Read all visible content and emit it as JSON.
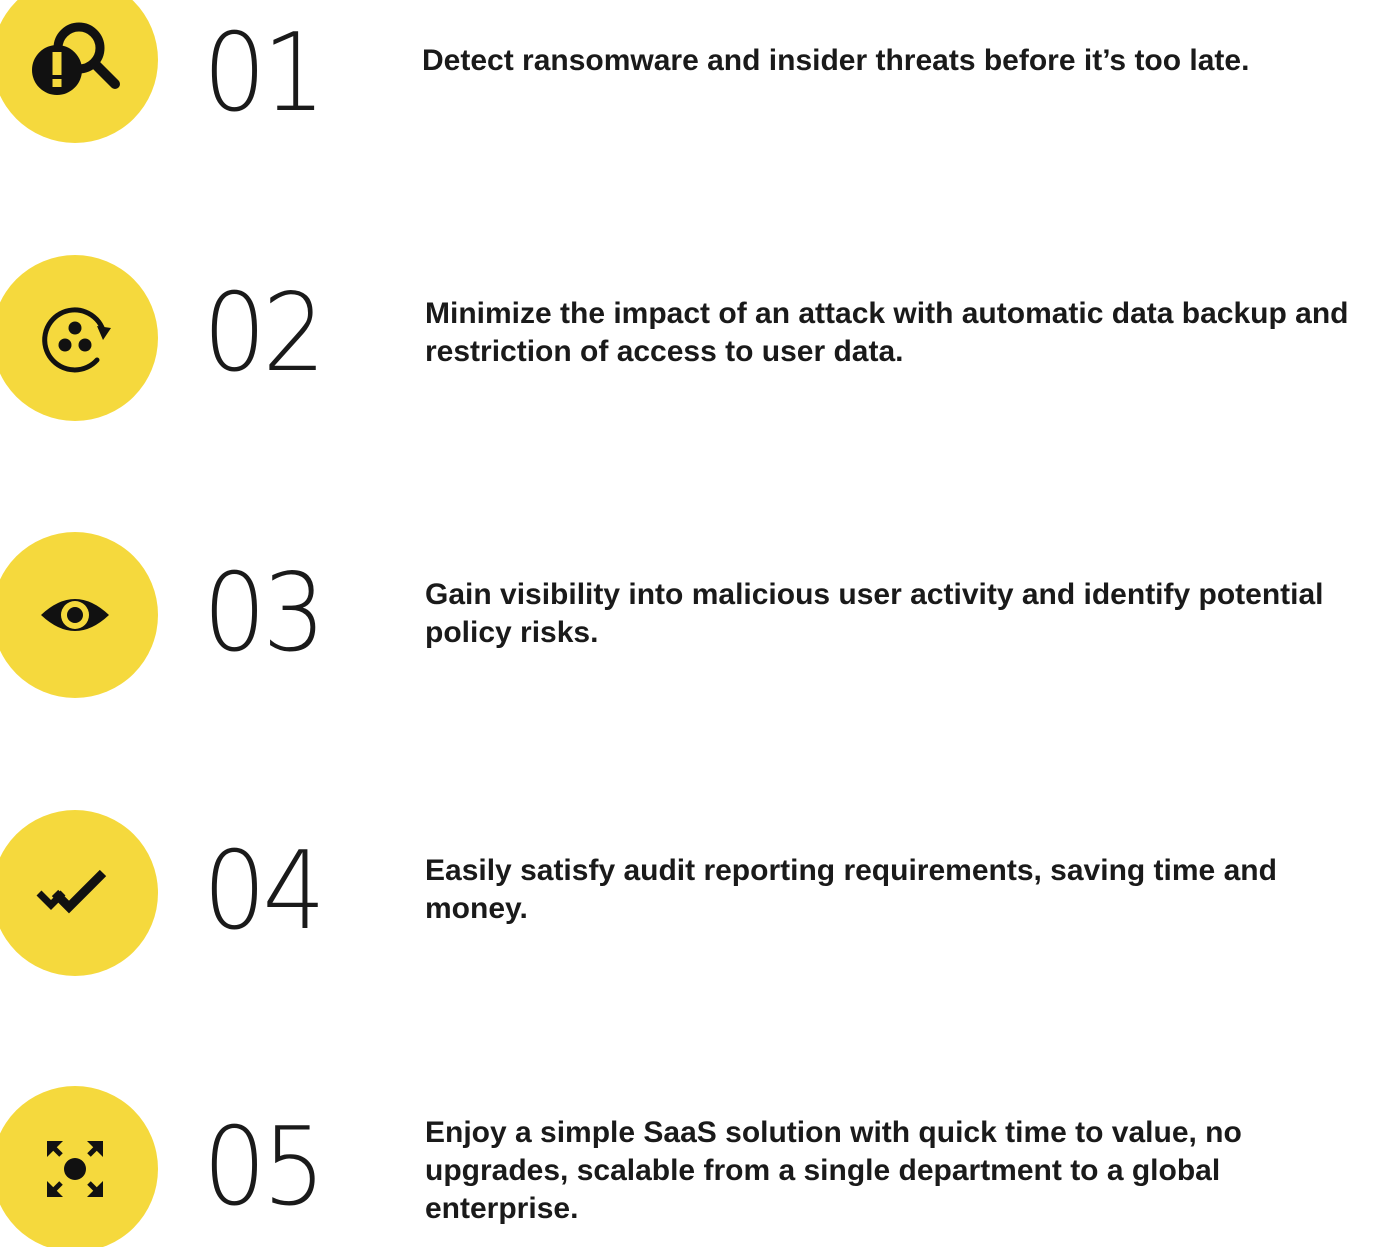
{
  "colors": {
    "accent": "#f5d93d",
    "icon": "#111111",
    "text": "#1a1a1a"
  },
  "features": [
    {
      "number": "01",
      "icon": "alert-search-icon",
      "text": "Detect ransomware and insider threats before it’s too late."
    },
    {
      "number": "02",
      "icon": "backup-cycle-icon",
      "text": "Minimize the impact of an attack with automatic data backup and restriction of access to user data."
    },
    {
      "number": "03",
      "icon": "eye-icon",
      "text": "Gain visibility into malicious user activity and identify potential policy risks."
    },
    {
      "number": "04",
      "icon": "double-check-icon",
      "text": "Easily satisfy audit reporting requirements, saving time and money."
    },
    {
      "number": "05",
      "icon": "expand-arrows-icon",
      "text": "Enjoy a simple SaaS solution with quick time to value, no upgrades, scalable from a single department to a global enterprise."
    }
  ]
}
